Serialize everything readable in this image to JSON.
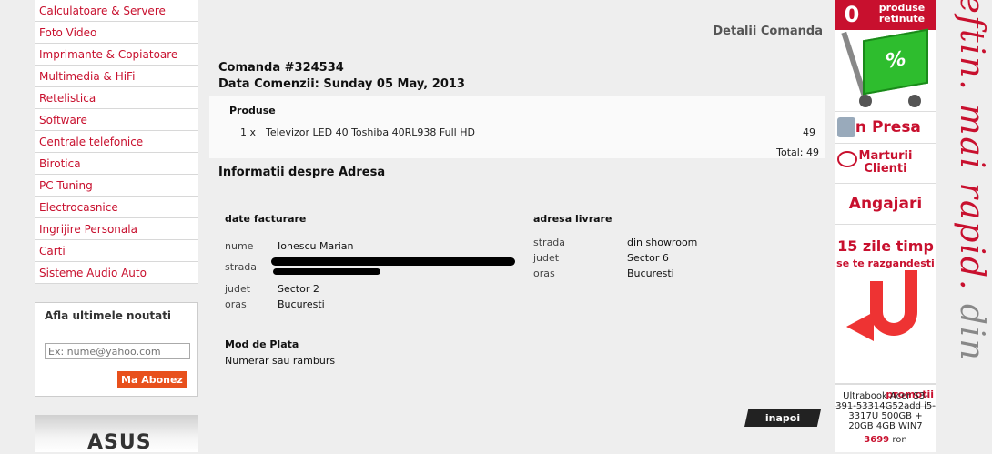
{
  "sidebar": {
    "categories": [
      "Calculatoare & Servere",
      "Foto Video",
      "Imprimante & Copiatoare",
      "Multimedia & HiFi",
      "Retelistica",
      "Software",
      "Centrale telefonice",
      "Birotica",
      "PC Tuning",
      "Electrocasnice",
      "Ingrijire Personala",
      "Carti",
      "Sisteme Audio Auto"
    ],
    "newsletter": {
      "title": "Afla ultimele noutati",
      "placeholder": "Ex: nume@yahoo.com",
      "button": "Ma Abonez"
    },
    "banner_brand": "ASUS"
  },
  "main": {
    "page_title": "Detalii Comanda",
    "order_title": "Comanda #324534",
    "order_date": "Data Comenzii: Sunday 05 May, 2013",
    "products_header": "Produse",
    "products": [
      {
        "qty": "1 x",
        "name": "Televizor LED 40 Toshiba 40RL938 Full HD",
        "price": "49"
      }
    ],
    "total": "Total: 49",
    "address_title": "Informatii despre Adresa",
    "billing": {
      "title": "date facturare",
      "rows": [
        {
          "label": "nume",
          "value": "Ionescu Marian"
        },
        {
          "label": "strada",
          "value": ""
        },
        {
          "label": "judet",
          "value": "Sector 2"
        },
        {
          "label": "oras",
          "value": "Bucuresti"
        }
      ]
    },
    "delivery": {
      "title": "adresa livrare",
      "rows": [
        {
          "label": "strada",
          "value": "din showroom"
        },
        {
          "label": "judet",
          "value": "Sector 6"
        },
        {
          "label": "oras",
          "value": "Bucuresti"
        }
      ]
    },
    "payment": {
      "title": "Mod de Plata",
      "value": "Numerar sau ramburs"
    },
    "back_button": "inapoi"
  },
  "right_panel": {
    "cart_count": "0",
    "cart_label": "produse retinute",
    "cart_percent": "%",
    "presa": "in Presa",
    "clienti": "Marturii Clienti",
    "angajari": "Angajari",
    "zile_title": "15 zile timp",
    "zile_sub": "se te razgandesti",
    "promotii": "promotii",
    "product": "Ultrabook Acer S3-391-53314G52add i5-3317U 500GB + 20GB 4GB WIN7",
    "price": "3699",
    "currency": "ron"
  },
  "slogan": "ieftin. mai rapid. din",
  "colors": {
    "brand_red": "#c8102e",
    "orange": "#e8501c",
    "green": "#2ebd2e"
  }
}
